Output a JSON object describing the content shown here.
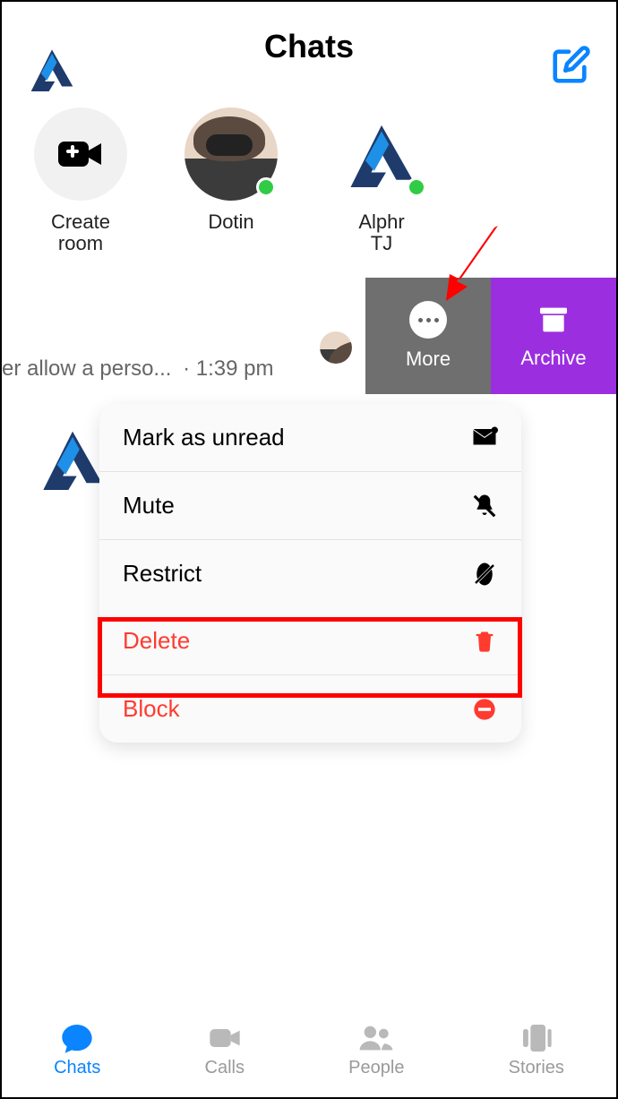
{
  "header": {
    "title": "Chats"
  },
  "rooms": [
    {
      "label": "Create\nroom"
    },
    {
      "label": "Dotin"
    },
    {
      "label": "Alphr\nTJ"
    }
  ],
  "chat_row": {
    "preview": "er allow a perso...",
    "time": "· 1:39 pm"
  },
  "swipe": {
    "more": "More",
    "archive": "Archive"
  },
  "menu": {
    "mark_unread": "Mark as unread",
    "mute": "Mute",
    "restrict": "Restrict",
    "delete": "Delete",
    "block": "Block"
  },
  "tabs": {
    "chats": "Chats",
    "calls": "Calls",
    "people": "People",
    "stories": "Stories"
  },
  "colors": {
    "accent": "#0a84ff",
    "danger": "#ff3b30",
    "archive": "#9b2fe0"
  }
}
